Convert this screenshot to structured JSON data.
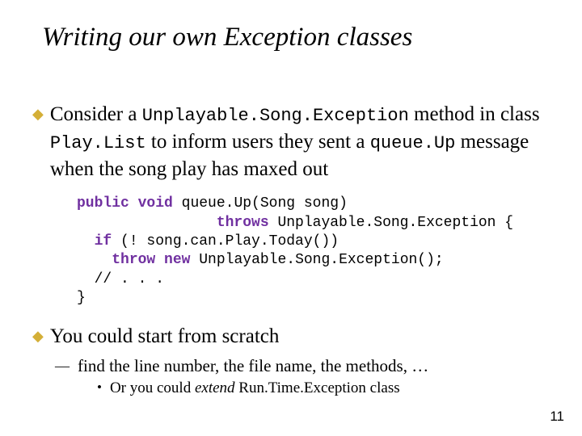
{
  "title": "Writing our own Exception classes",
  "bullet1": {
    "pre": "Consider a ",
    "code1": "Unplayable.Song.Exception",
    "mid1": " method in class ",
    "code2": "Play.List",
    "mid2": " to inform users they sent a ",
    "code3": "queue.Up",
    "post": " message when the song play has maxed out"
  },
  "code": {
    "kw_public": "public",
    "kw_void": "void",
    "sig_rest": " queue.Up(Song song)",
    "kw_throws": "throws",
    "throws_rest": " Unplayable.Song.Exception {",
    "kw_if": "if",
    "if_rest": " (! song.can.Play.Today())",
    "kw_throw": "throw",
    "kw_new": "new",
    "throw_rest": " Unplayable.Song.Exception();",
    "comment": "// . . .",
    "close": "}"
  },
  "bullet2": "You could start from scratch",
  "sub1": "find the line number, the file name, the methods, …",
  "sub2": {
    "pre": "Or you could ",
    "em": "extend",
    "post": " Run.Time.Exception class"
  },
  "page": "11"
}
